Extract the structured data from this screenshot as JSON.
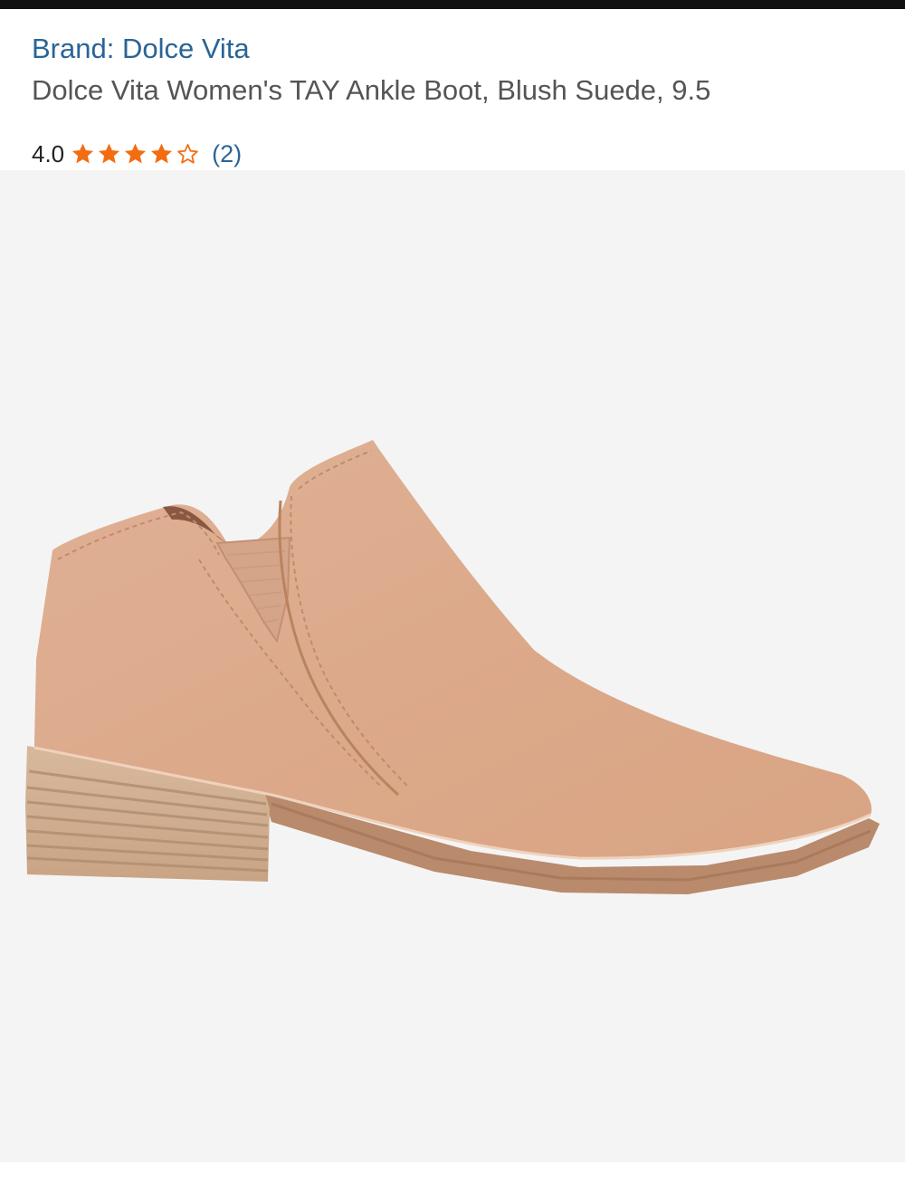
{
  "product": {
    "brand_link": "Brand: Dolce Vita",
    "title": "Dolce Vita Women's TAY Ankle Boot, Blush Suede, 9.5",
    "rating": {
      "value_text": "4.0",
      "stars_filled": 4,
      "stars_total": 5,
      "review_count_text": "(2)"
    },
    "image": {
      "alt": "Dolce Vita Women's TAY Ankle Boot, Blush Suede"
    }
  },
  "colors": {
    "link": "#2a6496",
    "star": "#f36c12",
    "title": "#555555",
    "image_bg": "#f4f4f4",
    "suede": "#ddab8d"
  },
  "icons": {
    "star_filled": "star-filled-icon",
    "star_empty": "star-outline-icon"
  }
}
